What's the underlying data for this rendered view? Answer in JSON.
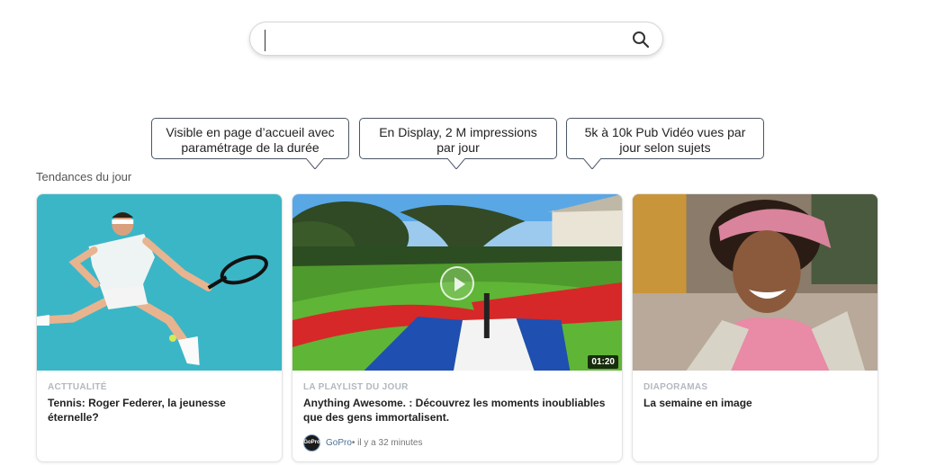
{
  "search": {
    "value": "",
    "placeholder": "",
    "icon": "search-icon"
  },
  "callouts": [
    {
      "line1": "Visible en page d’accueil avec",
      "line2": "paramétrage de la durée"
    },
    {
      "line1": "En Display, 2 M impressions",
      "line2": "par jour"
    },
    {
      "line1": "5k à 10k Pub Vidéo vues par",
      "line2": "jour selon sujets"
    }
  ],
  "section_title": "Tendances du jour",
  "cards": [
    {
      "category": "ACTTUALITÉ",
      "title": "Tennis: Roger Federer, la jeunesse éternelle?",
      "image": "tennis-player-photo"
    },
    {
      "category": "LA PLAYLIST DU JOUR",
      "title": "Anything Awesome. :  Découvrez les moments inoubliables que des gens immortalisent.",
      "duration": "01:20",
      "source_name": "GoPro",
      "source_meta": " • il y a 32 minutes",
      "avatar_text": "GoPro",
      "image": "gopro-dirtbike-video-thumbnail"
    },
    {
      "category": "DIAPORAMAS",
      "title": "La semaine en image",
      "image": "smiling-woman-photo"
    }
  ],
  "colors": {
    "callout_border": "#4b5563",
    "category": "#b3b8bf",
    "tennis_bg": "#3bb6c6"
  }
}
